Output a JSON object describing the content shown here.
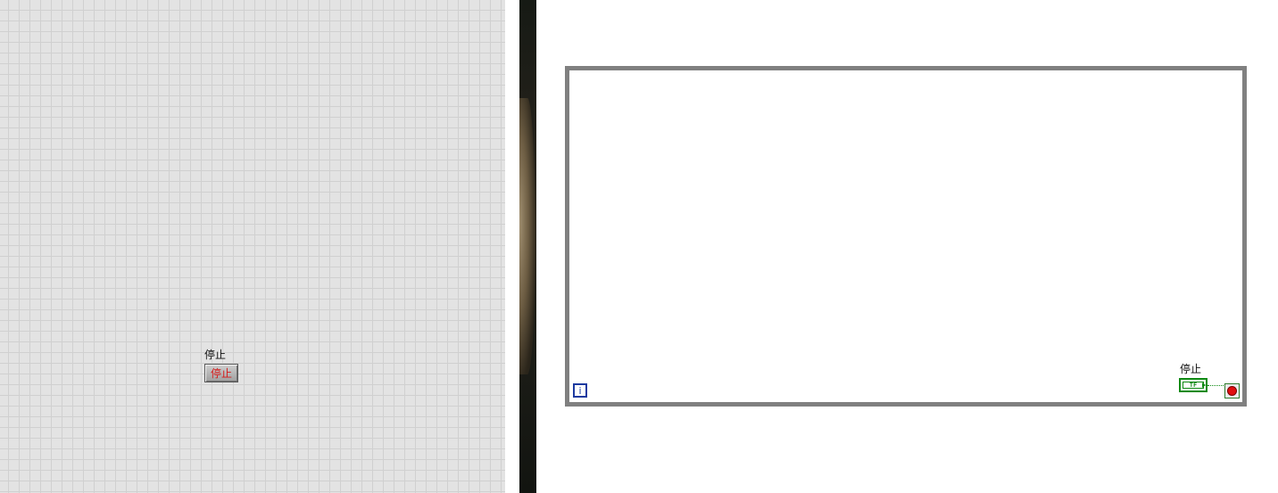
{
  "front_panel": {
    "stop_control": {
      "label": "停止",
      "button_text": "停止"
    }
  },
  "block_diagram": {
    "while_loop": {
      "iteration_terminal": "i",
      "stop_terminal_label": "停止",
      "boolean_terminal_text": "TF",
      "conditional_terminal_icon": "stop-if-true-icon"
    }
  },
  "colors": {
    "front_panel_bg": "#e3e3e3",
    "grid": "#d0d0d0",
    "loop_border": "#808080",
    "boolean_wire": "#0f8a14",
    "iteration_blue": "#1d3aa0",
    "stop_red": "#e01010"
  }
}
